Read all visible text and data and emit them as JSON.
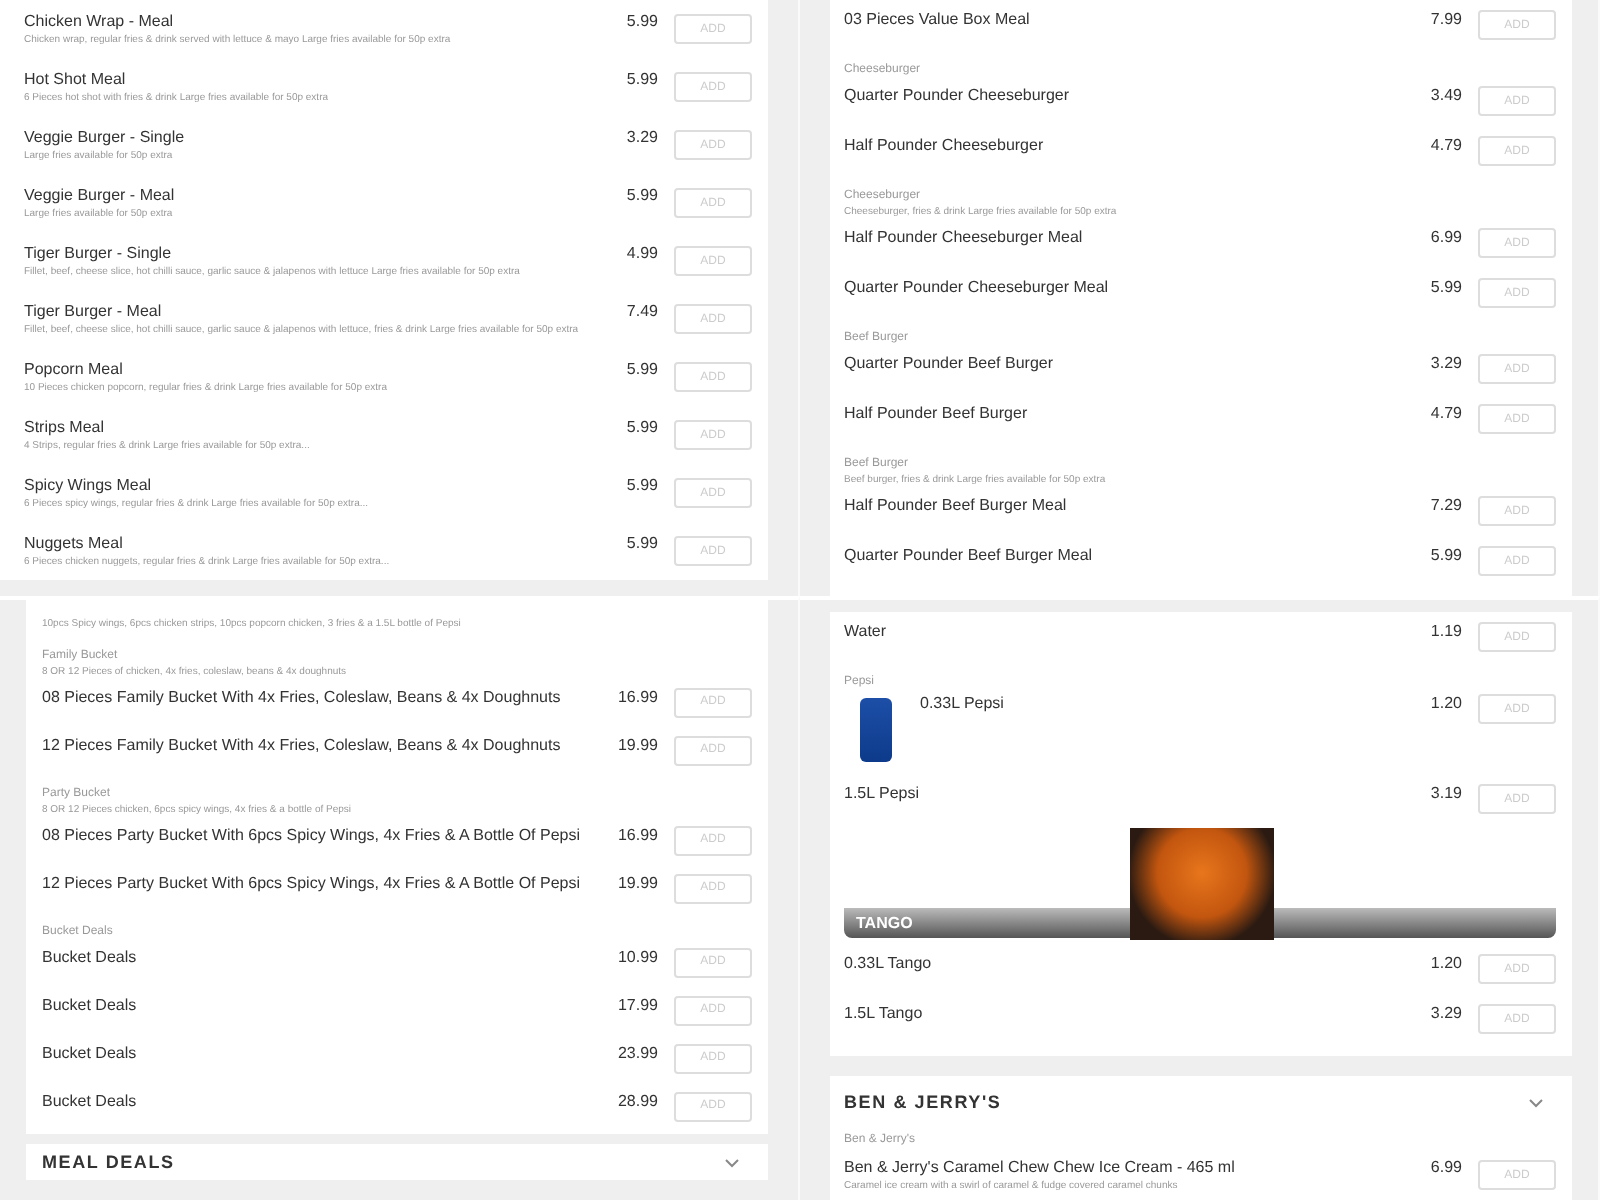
{
  "rows": [
    {
      "panels": [
        {
          "cards": [
            {
              "blocks": [
                {
                  "kind": "item",
                  "name": "Chicken Wrap - Meal",
                  "desc": "Chicken wrap, regular fries & drink served with lettuce & mayo Large fries available for 50p extra",
                  "price": "5.99",
                  "button": "ADD"
                },
                {
                  "kind": "item",
                  "name": "Hot Shot Meal",
                  "desc": "6 Pieces hot shot with fries & drink Large fries available for 50p extra",
                  "price": "5.99",
                  "button": "ADD"
                },
                {
                  "kind": "item",
                  "name": "Veggie Burger - Single",
                  "desc": "Large fries available for 50p extra",
                  "price": "3.29",
                  "button": "ADD"
                },
                {
                  "kind": "item",
                  "name": "Veggie Burger - Meal",
                  "desc": "Large fries available for 50p extra",
                  "price": "5.99",
                  "button": "ADD"
                },
                {
                  "kind": "item",
                  "name": "Tiger Burger - Single",
                  "desc": "Fillet, beef, cheese slice, hot chilli sauce, garlic sauce & jalapenos with lettuce Large fries available for 50p extra",
                  "price": "4.99",
                  "button": "ADD"
                },
                {
                  "kind": "item",
                  "name": "Tiger Burger - Meal",
                  "desc": "Fillet, beef, cheese slice, hot chilli sauce, garlic sauce & jalapenos with lettuce, fries & drink Large fries available for 50p extra",
                  "price": "7.49",
                  "button": "ADD"
                },
                {
                  "kind": "item",
                  "name": "Popcorn Meal",
                  "desc": "10 Pieces chicken popcorn, regular fries & drink Large fries available for 50p extra",
                  "price": "5.99",
                  "button": "ADD"
                },
                {
                  "kind": "item",
                  "name": "Strips Meal",
                  "desc": "4 Strips, regular fries & drink Large fries available for 50p extra...",
                  "price": "5.99",
                  "button": "ADD"
                },
                {
                  "kind": "item",
                  "name": "Spicy Wings Meal",
                  "desc": "6 Pieces spicy wings, regular fries & drink Large fries available for 50p extra...",
                  "price": "5.99",
                  "button": "ADD"
                },
                {
                  "kind": "item",
                  "name": "Nuggets Meal",
                  "desc": "6 Pieces chicken nuggets, regular fries & drink Large fries available for 50p extra...",
                  "price": "5.99",
                  "button": "ADD"
                }
              ]
            }
          ]
        },
        {
          "cards": [
            {
              "blocks": [
                {
                  "kind": "item",
                  "name": "03 Pieces Value Box Meal",
                  "price": "7.99",
                  "button": "ADD"
                },
                {
                  "kind": "group",
                  "title": "Cheeseburger"
                },
                {
                  "kind": "item",
                  "name": "Quarter Pounder Cheeseburger",
                  "price": "3.49",
                  "button": "ADD"
                },
                {
                  "kind": "item",
                  "name": "Half Pounder Cheeseburger",
                  "price": "4.79",
                  "button": "ADD"
                },
                {
                  "kind": "group",
                  "title": "Cheeseburger",
                  "desc": "Cheeseburger, fries & drink Large fries available for 50p extra"
                },
                {
                  "kind": "item",
                  "name": "Half Pounder Cheeseburger Meal",
                  "price": "6.99",
                  "button": "ADD"
                },
                {
                  "kind": "item",
                  "name": "Quarter Pounder Cheeseburger Meal",
                  "price": "5.99",
                  "button": "ADD"
                },
                {
                  "kind": "group",
                  "title": "Beef Burger"
                },
                {
                  "kind": "item",
                  "name": "Quarter Pounder Beef Burger",
                  "price": "3.29",
                  "button": "ADD"
                },
                {
                  "kind": "item",
                  "name": "Half Pounder Beef Burger",
                  "price": "4.79",
                  "button": "ADD"
                },
                {
                  "kind": "group",
                  "title": "Beef Burger",
                  "desc": "Beef burger, fries & drink Large fries available for 50p extra"
                },
                {
                  "kind": "item",
                  "name": "Half Pounder Beef Burger Meal",
                  "price": "7.29",
                  "button": "ADD"
                },
                {
                  "kind": "item",
                  "name": "Quarter Pounder Beef Burger Meal",
                  "price": "5.99",
                  "button": "ADD"
                }
              ]
            }
          ]
        }
      ]
    },
    {
      "panels": [
        {
          "cards": [
            {
              "blocks": [
                {
                  "kind": "note",
                  "desc": "10pcs Spicy wings, 6pcs chicken strips, 10pcs popcorn chicken, 3 fries & a 1.5L bottle of Pepsi"
                },
                {
                  "kind": "group",
                  "title": "Family Bucket",
                  "desc": "8 OR 12 Pieces of chicken, 4x fries, coleslaw, beans & 4x doughnuts"
                },
                {
                  "kind": "item",
                  "name": "08 Pieces Family Bucket With 4x Fries, Coleslaw, Beans & 4x Doughnuts",
                  "price": "16.99",
                  "button": "ADD"
                },
                {
                  "kind": "item",
                  "name": "12 Pieces Family Bucket With 4x Fries, Coleslaw, Beans & 4x Doughnuts",
                  "price": "19.99",
                  "button": "ADD"
                },
                {
                  "kind": "group",
                  "title": "Party Bucket",
                  "desc": "8 OR 12 Pieces chicken, 6pcs spicy wings, 4x fries & a bottle of Pepsi"
                },
                {
                  "kind": "item",
                  "name": "08 Pieces Party Bucket With 6pcs Spicy Wings, 4x Fries & A Bottle Of Pepsi",
                  "price": "16.99",
                  "button": "ADD"
                },
                {
                  "kind": "item",
                  "name": "12 Pieces Party Bucket With 6pcs Spicy Wings, 4x Fries & A Bottle Of Pepsi",
                  "price": "19.99",
                  "button": "ADD"
                },
                {
                  "kind": "group",
                  "title": "Bucket Deals"
                },
                {
                  "kind": "item",
                  "name": "Bucket Deals",
                  "price": "10.99",
                  "button": "ADD"
                },
                {
                  "kind": "item",
                  "name": "Bucket Deals",
                  "price": "17.99",
                  "button": "ADD"
                },
                {
                  "kind": "item",
                  "name": "Bucket Deals",
                  "price": "23.99",
                  "button": "ADD"
                },
                {
                  "kind": "item",
                  "name": "Bucket Deals",
                  "price": "28.99",
                  "button": "ADD"
                }
              ]
            },
            {
              "header": {
                "title": "MEAL DEALS"
              }
            }
          ]
        },
        {
          "cards": [
            {
              "blocks": [
                {
                  "kind": "item",
                  "name": "Water",
                  "price": "1.19",
                  "button": "ADD"
                },
                {
                  "kind": "group",
                  "title": "Pepsi"
                },
                {
                  "kind": "item",
                  "name": "0.33L Pepsi",
                  "price": "1.20",
                  "button": "ADD",
                  "photo": true
                },
                {
                  "kind": "item",
                  "name": "1.5L Pepsi",
                  "price": "3.19",
                  "button": "ADD"
                },
                {
                  "kind": "banner",
                  "label": "TANGO"
                },
                {
                  "kind": "item",
                  "name": "0.33L Tango",
                  "price": "1.20",
                  "button": "ADD"
                },
                {
                  "kind": "item",
                  "name": "1.5L Tango",
                  "price": "3.29",
                  "button": "ADD"
                }
              ]
            },
            {
              "header": {
                "title": "BEN & JERRY'S"
              },
              "blocks": [
                {
                  "kind": "group",
                  "title": "Ben & Jerry's"
                },
                {
                  "kind": "item",
                  "name": "Ben & Jerry's Caramel Chew Chew Ice Cream - 465 ml",
                  "desc": "Caramel ice cream with a swirl of caramel & fudge covered caramel chunks",
                  "price": "6.99",
                  "button": "ADD"
                }
              ]
            }
          ]
        }
      ]
    }
  ]
}
